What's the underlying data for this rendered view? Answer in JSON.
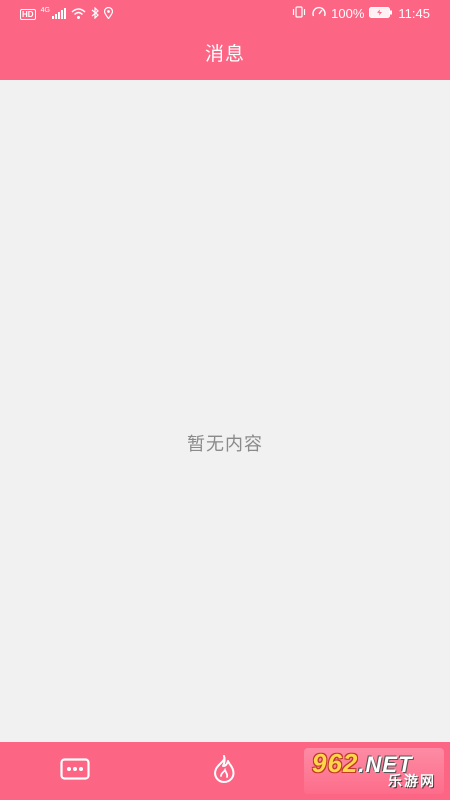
{
  "status_bar": {
    "hd_badge": "HD",
    "network_type": "4G",
    "battery_percent": "100%",
    "time": "11:45",
    "icons": [
      "signal-icon",
      "wifi-icon",
      "bluetooth-icon",
      "location-icon",
      "vibrate-icon",
      "speed-icon",
      "battery-icon"
    ]
  },
  "header": {
    "title": "消息"
  },
  "main": {
    "empty_text": "暂无内容"
  },
  "bottom_nav": {
    "items": [
      {
        "icon": "more-icon"
      },
      {
        "icon": "fire-icon"
      }
    ]
  },
  "watermark": {
    "logo_number": "962",
    "logo_suffix": ".NET",
    "site_name": "乐游网"
  },
  "colors": {
    "primary": "#fd6585",
    "background": "#f1f1f1",
    "empty_text": "#8a8a8a"
  }
}
